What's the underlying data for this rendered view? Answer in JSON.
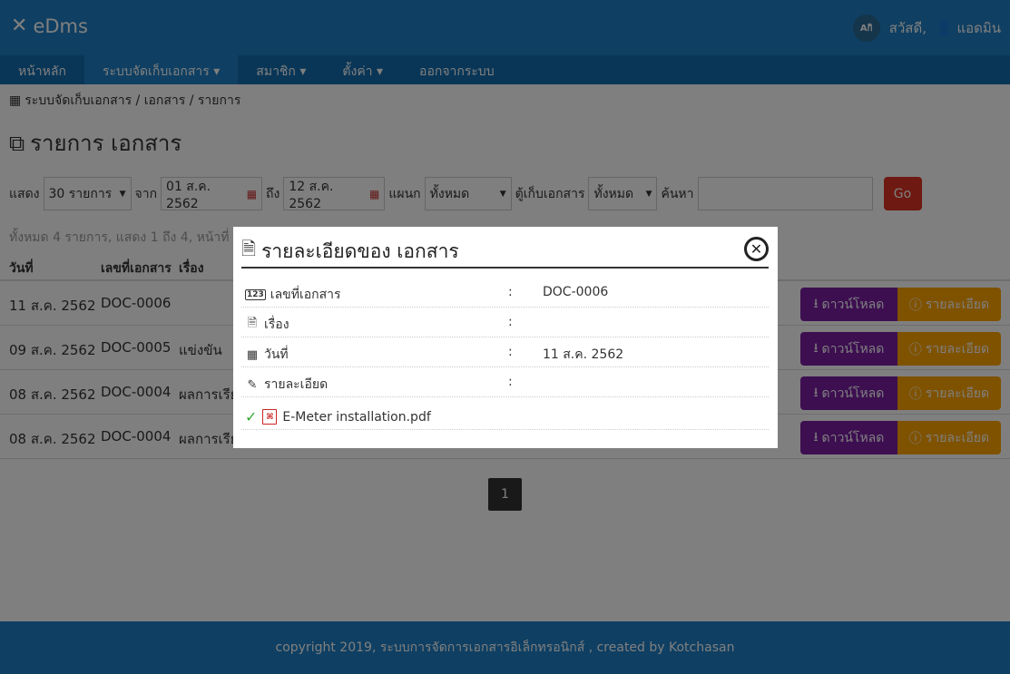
{
  "header": {
    "app_name": "eDms",
    "lang_badge": "Aกิ",
    "greeting": "สวัสดี,",
    "user_name": "แอดมิน"
  },
  "menu": [
    {
      "label": "หน้าหลัก"
    },
    {
      "label": "ระบบจัดเก็บเอกสาร ▾"
    },
    {
      "label": "สมาชิก ▾"
    },
    {
      "label": "ตั้งค่า ▾"
    },
    {
      "label": "ออกจากระบบ"
    }
  ],
  "breadcrumb": "ระบบจัดเก็บเอกสาร / เอกสาร / รายการ",
  "page_title": "รายการ เอกสาร",
  "filters": {
    "show_label": "แสดง",
    "show_value": "30 รายการ",
    "from_label": "จาก",
    "from_value": "01 ส.ค. 2562",
    "to_label": "ถึง",
    "to_value": "12 ส.ค. 2562",
    "dept_label": "แผนก",
    "dept_value": "ทั้งหมด",
    "cabinet_label": "ตู้เก็บเอกสาร",
    "cabinet_value": "ทั้งหมด",
    "search_label": "ค้นหา",
    "search_value": "",
    "go_label": "Go"
  },
  "summary": "ทั้งหมด 4 รายการ, แสดง 1 ถึง 4, หน้าที่",
  "table": {
    "headers": {
      "date": "วันที่",
      "doc_no": "เลขที่เอกสาร",
      "topic": "เรื่อง"
    },
    "rows": [
      {
        "date": "11 ส.ค. 2562",
        "doc_no": "DOC-0006",
        "topic": ""
      },
      {
        "date": "09 ส.ค. 2562",
        "doc_no": "DOC-0005",
        "topic": "แข่งขัน"
      },
      {
        "date": "08 ส.ค. 2562",
        "doc_no": "DOC-0004",
        "topic": "ผลการเรีย"
      },
      {
        "date": "08 ส.ค. 2562",
        "doc_no": "DOC-0004",
        "topic": "ผลการเรีย"
      }
    ],
    "download_label": "ดาวน์โหลด",
    "detail_label": "รายละเอียด"
  },
  "pager": {
    "page": "1"
  },
  "footer": "copyright 2019, ระบบการจัดการเอกสารอิเล็กทรอนิกส์ , created by Kotchasan",
  "modal": {
    "title": "รายละเอียดของ เอกสาร",
    "rows": [
      {
        "label": "เลขที่เอกสาร",
        "value": "DOC-0006",
        "icon": "numbers-icon"
      },
      {
        "label": "เรื่อง",
        "value": "",
        "icon": "document-icon"
      },
      {
        "label": "วันที่",
        "value": "11 ส.ค. 2562",
        "icon": "calendar-icon"
      },
      {
        "label": "รายละเอียด",
        "value": "",
        "icon": "pencil-icon"
      }
    ],
    "colon": ":",
    "file_name": "E-Meter installation.pdf",
    "icon_123": "123"
  }
}
